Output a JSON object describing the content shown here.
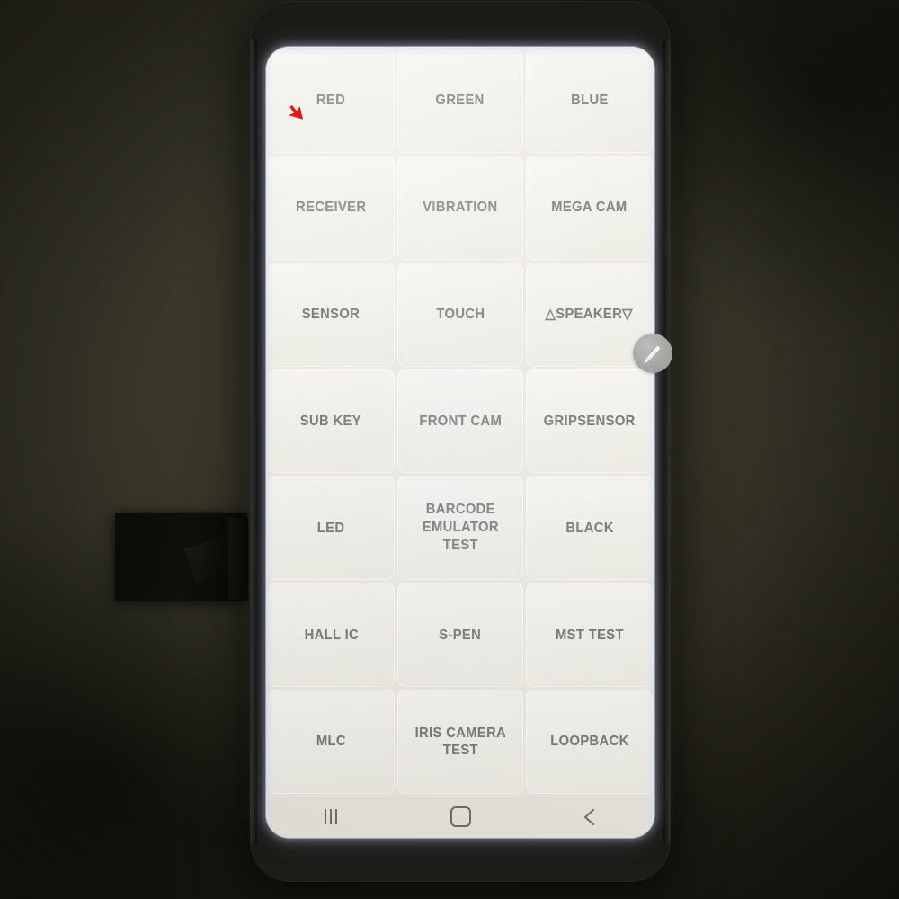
{
  "device": {
    "kind": "smartphone",
    "screen_mode": "diagnostic-test-menu"
  },
  "screen": {
    "grid": {
      "columns": 3,
      "rows": 7,
      "tiles": [
        {
          "label": "RED",
          "name": "tile-red"
        },
        {
          "label": "GREEN",
          "name": "tile-green"
        },
        {
          "label": "BLUE",
          "name": "tile-blue"
        },
        {
          "label": "RECEIVER",
          "name": "tile-receiver"
        },
        {
          "label": "VIBRATION",
          "name": "tile-vibration"
        },
        {
          "label": "MEGA CAM",
          "name": "tile-mega-cam"
        },
        {
          "label": "SENSOR",
          "name": "tile-sensor"
        },
        {
          "label": "TOUCH",
          "name": "tile-touch"
        },
        {
          "label": "△SPEAKER▽",
          "name": "tile-speaker"
        },
        {
          "label": "SUB KEY",
          "name": "tile-sub-key"
        },
        {
          "label": "FRONT CAM",
          "name": "tile-front-cam"
        },
        {
          "label": "GRIPSENSOR",
          "name": "tile-gripsensor"
        },
        {
          "label": "LED",
          "name": "tile-led"
        },
        {
          "label": "BARCODE\nEMULATOR TEST",
          "name": "tile-barcode-emulator-test"
        },
        {
          "label": "BLACK",
          "name": "tile-black"
        },
        {
          "label": "HALL IC",
          "name": "tile-hall-ic"
        },
        {
          "label": "S-PEN",
          "name": "tile-s-pen"
        },
        {
          "label": "MST TEST",
          "name": "tile-mst-test"
        },
        {
          "label": "MLC",
          "name": "tile-mlc"
        },
        {
          "label": "IRIS CAMERA TEST",
          "name": "tile-iris-camera-test"
        },
        {
          "label": "LOOPBACK",
          "name": "tile-loopback"
        }
      ]
    },
    "floating_button": {
      "icon": "pen-icon",
      "label": ""
    },
    "navbar": {
      "recents_icon": "recents-icon",
      "home_icon": "home-icon",
      "back_icon": "back-icon"
    }
  },
  "cursor": {
    "icon": "mouse-pointer-icon",
    "color": "#e8181a"
  },
  "colors": {
    "background": "#2c2b21",
    "phone_body": "#101010",
    "screen_bg": "#f2f1ec",
    "tile_bg": "#f4f3ee",
    "tile_text": "#7d7d79",
    "navbar_bg": "#e9e7df",
    "navbar_icon": "#6f6f6b",
    "float_button": "#a6a6a4",
    "cursor_red": "#e8181a"
  }
}
